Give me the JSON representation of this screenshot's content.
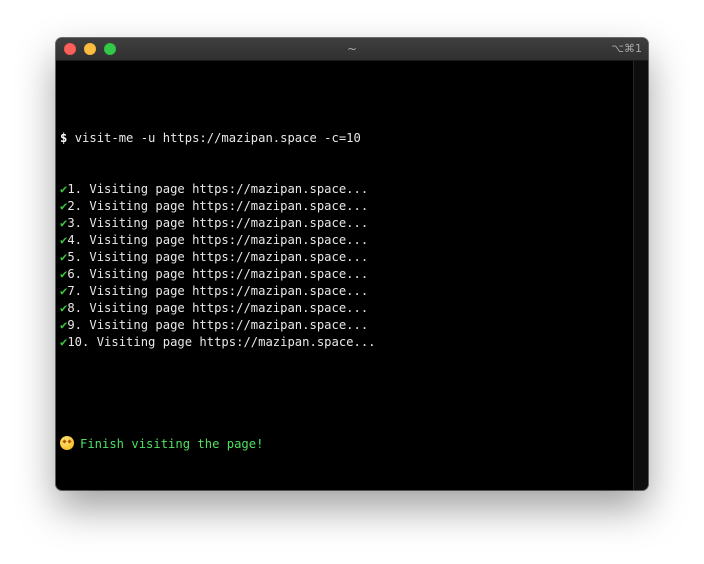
{
  "window": {
    "title": "~",
    "shortcut": "⌥⌘1"
  },
  "terminal": {
    "prompt_symbol": "$",
    "command": "visit-me -u https://mazipan.space -c=10",
    "check_symbol": "✔",
    "lines": [
      "1. Visiting page https://mazipan.space...",
      "2. Visiting page https://mazipan.space...",
      "3. Visiting page https://mazipan.space...",
      "4. Visiting page https://mazipan.space...",
      "5. Visiting page https://mazipan.space...",
      "6. Visiting page https://mazipan.space...",
      "7. Visiting page https://mazipan.space...",
      "8. Visiting page https://mazipan.space...",
      "9. Visiting page https://mazipan.space...",
      "10. Visiting page https://mazipan.space..."
    ],
    "finish_message": "Finish visiting the page!",
    "finish_icon": "star-struck-emoji-icon"
  },
  "colors": {
    "check": "#3ec93e",
    "finish_text": "#50e060",
    "background": "#000000"
  }
}
